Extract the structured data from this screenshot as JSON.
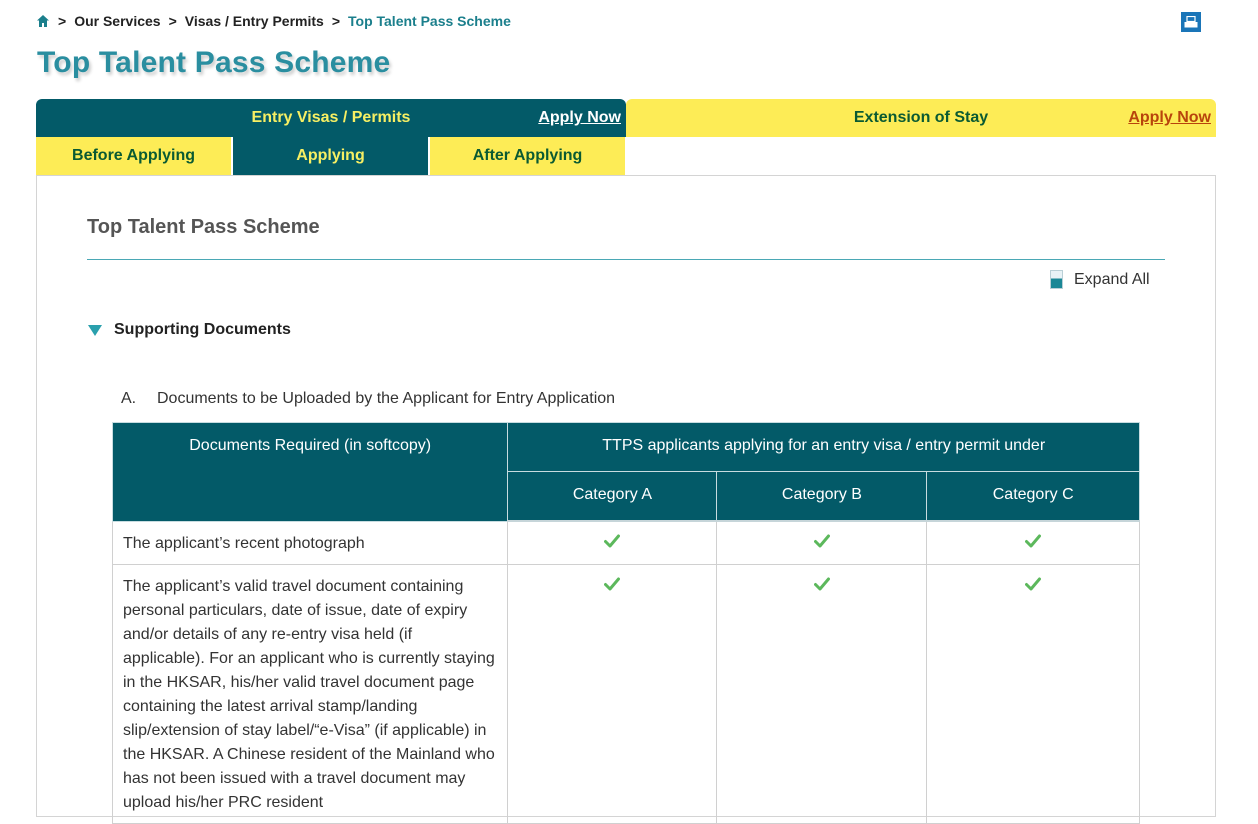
{
  "breadcrumb": {
    "home_icon": "home-icon",
    "separator": ">",
    "items": [
      {
        "label": "Our Services"
      },
      {
        "label": "Visas / Entry Permits"
      },
      {
        "label": "Top Talent Pass Scheme",
        "current": true
      }
    ]
  },
  "print_icon": "print-icon",
  "page_title": "Top Talent Pass Scheme",
  "top_tabs": [
    {
      "label": "Entry Visas / Permits",
      "apply": "Apply Now",
      "active": true
    },
    {
      "label": "Extension of Stay",
      "apply": "Apply Now",
      "active": false
    }
  ],
  "sub_tabs": [
    {
      "label": "Before Applying",
      "active": false
    },
    {
      "label": "Applying",
      "active": true
    },
    {
      "label": "After Applying",
      "active": false
    }
  ],
  "section": {
    "title": "Top Talent Pass Scheme",
    "expand_all": "Expand All",
    "accordion": {
      "title": "Supporting Documents",
      "expanded": true,
      "list_marker": "A.",
      "list_heading": "Documents to be Uploaded by the Applicant for Entry Application",
      "table": {
        "header_main": "Documents Required (in softcopy)",
        "header_group": "TTPS applicants applying for an entry visa / entry permit under",
        "categories": [
          "Category A",
          "Category B",
          "Category C"
        ],
        "rows": [
          {
            "document": "The applicant’s recent photograph",
            "required": [
              true,
              true,
              true
            ]
          },
          {
            "document": "The applicant’s valid travel document containing personal particulars, date of issue, date of expiry and/or details of any re-entry visa held (if applicable). For an applicant who is currently staying in the HKSAR, his/her valid travel document page containing the latest arrival stamp/landing slip/extension of stay label/“e-Visa” (if applicable) in the HKSAR. A Chinese resident of the Mainland who has not been issued with a travel document may upload his/her PRC resident",
            "required": [
              true,
              true,
              true
            ]
          }
        ]
      }
    }
  },
  "colors": {
    "teal_dark": "#035a68",
    "title_teal": "#2a8ea0",
    "yellow": "#fdec56",
    "tab_text_yellow": "#f7ef63",
    "tab_text_green": "#0a5a32",
    "apply_orange": "#b8440c",
    "check_green": "#5cb85c"
  }
}
